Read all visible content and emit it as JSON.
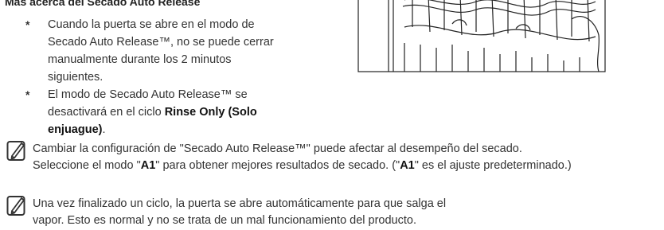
{
  "heading": "Más acerca del Secado Auto Release",
  "bullet1": {
    "star": "*",
    "text": "Cuando la puerta se abre en el modo de Secado Auto Release™, no se puede cerrar manualmente durante los 2 minutos siguientes."
  },
  "bullet2": {
    "star": "*",
    "pre": "El modo de Secado Auto Release™ se desactivará en el ciclo ",
    "bold": "Rinse Only (Solo enjuague)",
    "post": "."
  },
  "note1": {
    "line1": "Cambiar la configuración de \"Secado Auto Release™\" puede afectar al desempeño del secado.",
    "l2_pre": "Seleccione el modo \"",
    "l2_b1": "A1",
    "l2_mid": "\" para obtener mejores resultados de secado. (\"",
    "l2_b2": "A1",
    "l2_post": "\" es el ajuste predeterminado.)"
  },
  "note2": {
    "text": "Una vez finalizado un ciclo, la puerta se abre automáticamente para que salga el vapor. Esto es normal y no se trata de un mal funcionamiento del producto."
  },
  "icons": {
    "note": "note-pencil-icon"
  }
}
